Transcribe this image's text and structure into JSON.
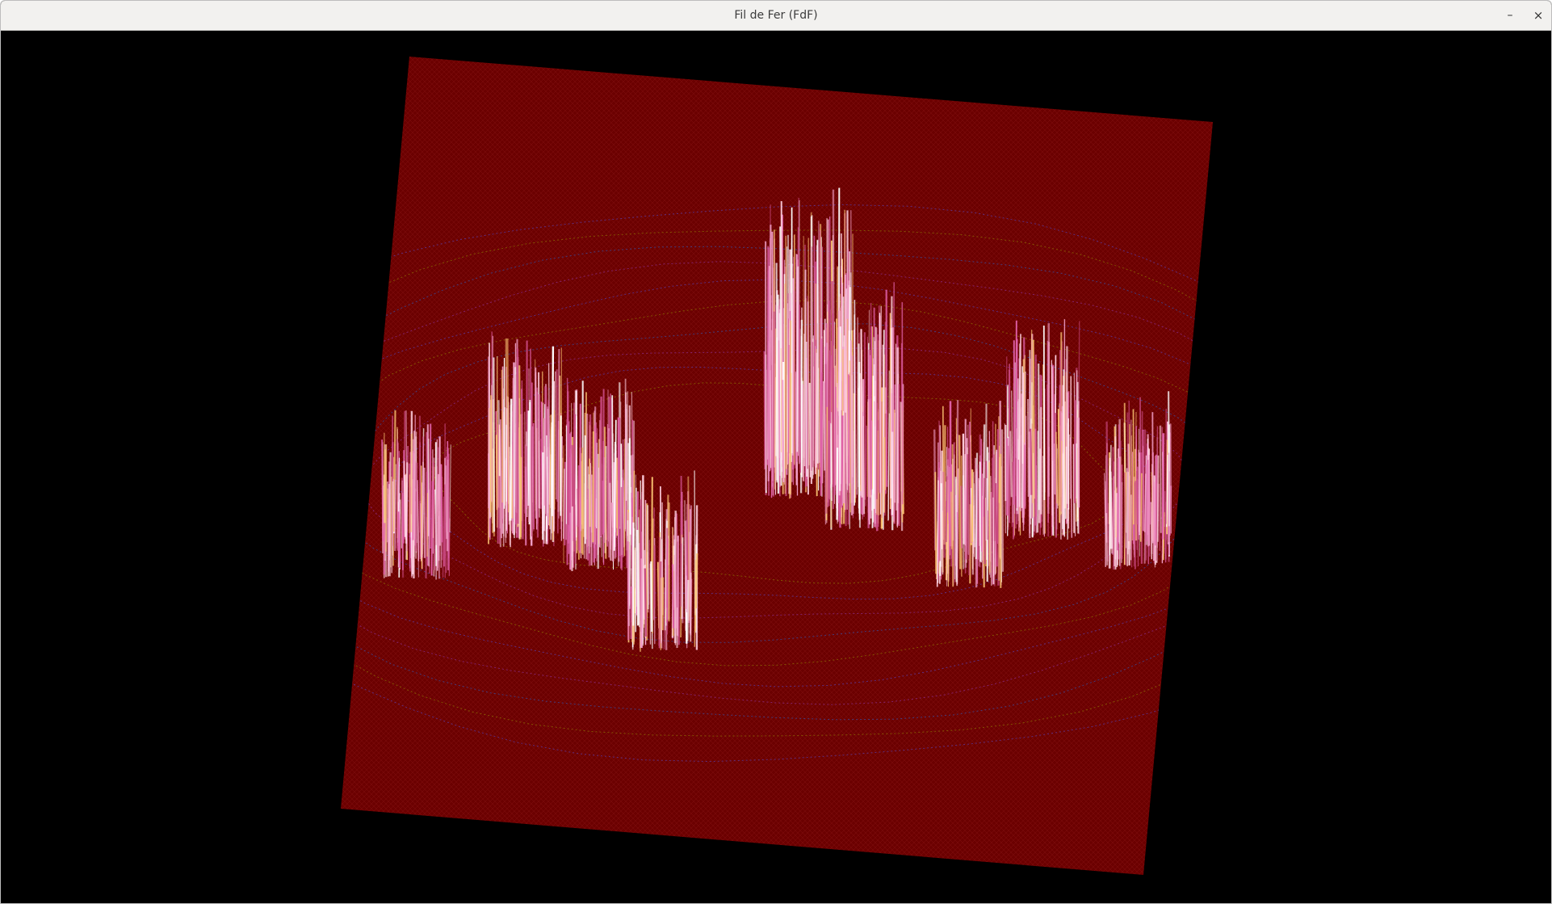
{
  "window": {
    "title": "Fil de Fer (FdF)",
    "controls": {
      "minimize_glyph": "–",
      "close_glyph": "×"
    }
  },
  "render": {
    "background_color": "#000000",
    "plane_color": "#6b0000",
    "grid_line_color": "#7a0a0a",
    "contour_colors": [
      "#8a6a00",
      "#5a3aa0",
      "#8a2a8a",
      "#3a4a9a"
    ],
    "peak_colors": [
      "#f2a0c8",
      "#e060a8",
      "#ffd0e0",
      "#ffffff",
      "#c84880",
      "#f8c070"
    ],
    "peaks": [
      {
        "label": "left-outer",
        "height": 0.35
      },
      {
        "label": "left-inner",
        "height": 0.55
      },
      {
        "label": "left-mid",
        "height": 0.45
      },
      {
        "label": "center-low",
        "height": 0.4
      },
      {
        "label": "center",
        "height": 1.0
      },
      {
        "label": "center-right",
        "height": 0.7
      },
      {
        "label": "right-mid",
        "height": 0.4
      },
      {
        "label": "right-inner",
        "height": 0.55
      },
      {
        "label": "right-outer",
        "height": 0.35
      }
    ]
  }
}
